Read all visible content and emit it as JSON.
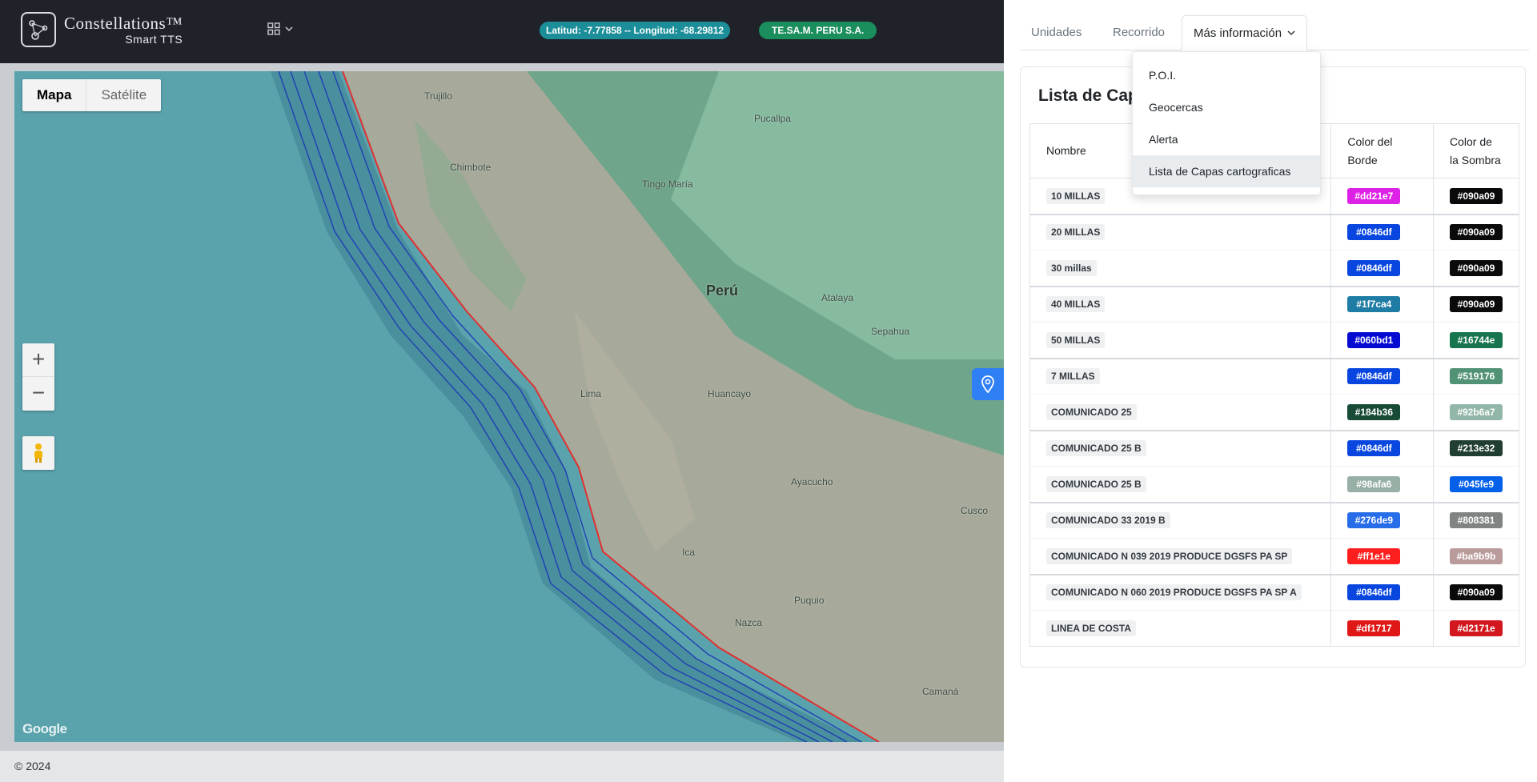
{
  "header": {
    "brand_title": "Constellations™",
    "brand_subtitle": "Smart TTS",
    "apps_icon": "grid-icon",
    "coordinates": "Latitud: -7.77858 -- Longitud: -68.29812",
    "company": "TE.SA.M. PERU S.A."
  },
  "map": {
    "type_buttons": [
      "Mapa",
      "Satélite"
    ],
    "active_type": "Mapa",
    "zoom_in": "+",
    "zoom_out": "−",
    "attribution": "Google",
    "labels": {
      "country": "Perú",
      "lima": "Lima",
      "trujillo": "Trujillo",
      "chimbote": "Chimbote",
      "huancayo": "Huancayo",
      "ayacucho": "Ayacucho",
      "ica": "Ica",
      "cusco": "Cusco",
      "pucallpa": "Pucallpa",
      "tingo_maria": "Tingo María",
      "nazca": "Nazca",
      "camana": "Camaná",
      "atalaya": "Atalaya",
      "sepahua": "Sepahua",
      "puquio": "Puquio"
    },
    "colors": {
      "sea": "#5aa3ad",
      "land": "#9aa596",
      "coast_line": "#e03131",
      "buffer_line": "#1f3fb5"
    }
  },
  "footer": {
    "copyright": "© 2024"
  },
  "panel": {
    "tabs": [
      {
        "label": "Unidades"
      },
      {
        "label": "Recorrido"
      },
      {
        "label": "Más información"
      }
    ],
    "dropdown": [
      "P.O.I.",
      "Geocercas",
      "Alerta",
      "Lista de Capas cartograficas"
    ],
    "dropdown_highlighted": "Lista de Capas cartograficas",
    "card_title": "Lista de Capas cartograficas",
    "table": {
      "headers": [
        "Nombre",
        "Color del Borde",
        "Color de la Sombra"
      ],
      "rows": [
        {
          "name": "10 MILLAS",
          "border": "#dd21e7",
          "shadow": "#090a09"
        },
        {
          "name": "20 MILLAS",
          "border": "#0846df",
          "shadow": "#090a09"
        },
        {
          "name": "30 millas",
          "border": "#0846df",
          "shadow": "#090a09"
        },
        {
          "name": "40 MILLAS",
          "border": "#1f7ca4",
          "shadow": "#090a09"
        },
        {
          "name": "50 MILLAS",
          "border": "#060bd1",
          "shadow": "#16744e"
        },
        {
          "name": "7 MILLAS",
          "border": "#0846df",
          "shadow": "#519176"
        },
        {
          "name": "COMUNICADO 25",
          "border": "#184b36",
          "shadow": "#92b6a7"
        },
        {
          "name": "COMUNICADO 25 B",
          "border": "#0846df",
          "shadow": "#213e32"
        },
        {
          "name": "COMUNICADO 25 B",
          "border": "#98afa6",
          "shadow": "#045fe9"
        },
        {
          "name": "COMUNICADO 33 2019 B",
          "border": "#276de9",
          "shadow": "#808381"
        },
        {
          "name": "COMUNICADO N 039 2019 PRODUCE DGSFS PA SP",
          "border": "#ff1e1e",
          "shadow": "#ba9b9b"
        },
        {
          "name": "COMUNICADO N 060 2019 PRODUCE DGSFS PA SP A",
          "border": "#0846df",
          "shadow": "#090a09"
        },
        {
          "name": "LINEA DE COSTA",
          "border": "#df1717",
          "shadow": "#d2171e"
        }
      ]
    }
  }
}
